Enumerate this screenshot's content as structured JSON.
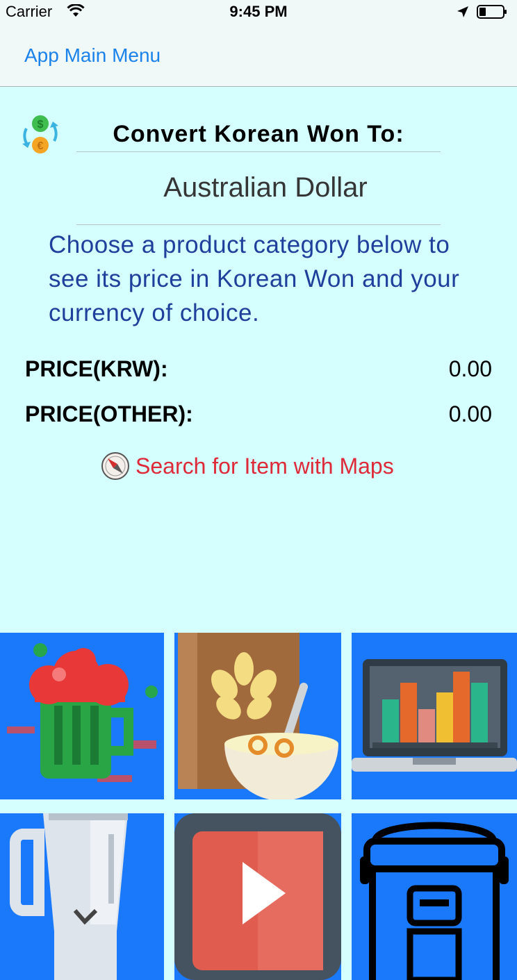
{
  "status_bar": {
    "carrier": "Carrier",
    "time": "9:45 PM",
    "icons": [
      "wifi-icon",
      "location-arrow-icon",
      "battery-icon"
    ]
  },
  "nav": {
    "back_label": "App Main Menu"
  },
  "converter": {
    "heading": "Convert Korean Won To:",
    "currency": "Australian Dollar",
    "instructions": "Choose a product category below to see its price in Korean Won and your currency of choice."
  },
  "prices": {
    "krw_label": "PRICE(KRW):",
    "krw_value": "0.00",
    "other_label": "PRICE(OTHER):",
    "other_value": "0.00"
  },
  "maps": {
    "label": "Search for Item with Maps",
    "icon": "compass-icon"
  },
  "categories": [
    {
      "icon": "beer-mug-icon"
    },
    {
      "icon": "cereal-bowl-icon"
    },
    {
      "icon": "laptop-chart-icon"
    },
    {
      "icon": "blender-icon"
    },
    {
      "icon": "video-play-icon"
    },
    {
      "icon": "rice-cooker-icon"
    }
  ],
  "colors": {
    "background": "#d4fffe",
    "link_blue": "#1a82ea",
    "instruction_blue": "#1f3f9c",
    "maps_red": "#de2a38",
    "tile_blue": "#1a78fb"
  }
}
